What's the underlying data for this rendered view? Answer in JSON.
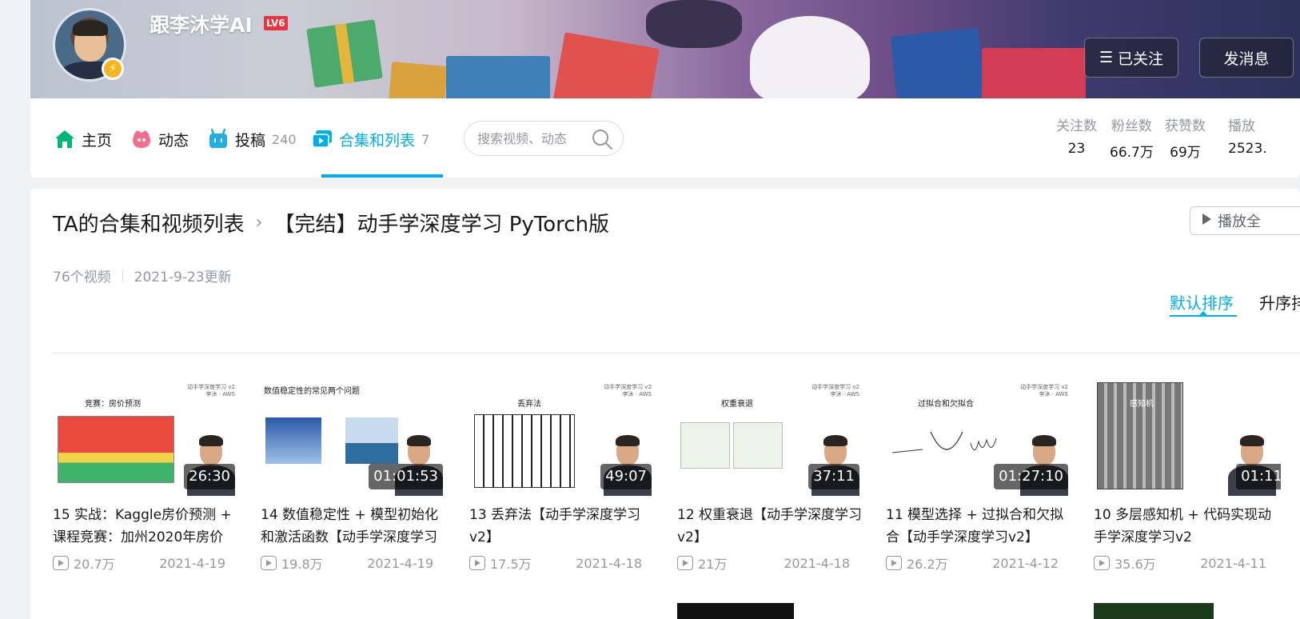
{
  "header": {
    "username": "跟李沐学AI",
    "level_badge": "LV6",
    "follow_button": "已关注",
    "message_button": "发消息"
  },
  "nav": {
    "items": [
      {
        "label": "主页",
        "count": "",
        "icon": "home-icon",
        "color": "#00b57a"
      },
      {
        "label": "动态",
        "count": "",
        "icon": "dynamic-icon",
        "color": "#f36f8e"
      },
      {
        "label": "投稿",
        "count": "240",
        "icon": "upload-icon",
        "color": "#23ade5"
      },
      {
        "label": "合集和列表",
        "count": "7",
        "icon": "collection-icon",
        "color": "#00aeec"
      }
    ],
    "active_index": 3,
    "search_placeholder": "搜索视频、动态",
    "stats": [
      {
        "label": "关注数",
        "value": "23"
      },
      {
        "label": "粉丝数",
        "value": "66.7万"
      },
      {
        "label": "获赞数",
        "value": "69万"
      },
      {
        "label": "播放",
        "value": "2523."
      }
    ]
  },
  "page": {
    "breadcrumb_root": "TA的合集和视频列表",
    "breadcrumb_current": "【完结】动手学深度学习 PyTorch版",
    "play_all": "播放全",
    "video_count": "76个视频",
    "updated": "2021-9-23更新",
    "sort_default": "默认排序",
    "sort_asc": "升序排"
  },
  "videos": [
    {
      "title": "15 实战：Kaggle房价预测 + 课程竞赛：加州2020年房价",
      "views": "20.7万",
      "date": "2021-4-19",
      "duration": "26:30",
      "slide_title": "竞赛：房价预测"
    },
    {
      "title": "14 数值稳定性 + 模型初始化和激活函数【动手学深度学习",
      "views": "19.8万",
      "date": "2021-4-19",
      "duration": "01:01:53",
      "slide_title": "数值稳定性的常见两个问题"
    },
    {
      "title": "13 丢弃法【动手学深度学习v2】",
      "views": "17.5万",
      "date": "2021-4-18",
      "duration": "49:07",
      "slide_title": "丢弃法"
    },
    {
      "title": "12 权重衰退【动手学深度学习v2】",
      "views": "21万",
      "date": "2021-4-18",
      "duration": "37:11",
      "slide_title": "权重衰退"
    },
    {
      "title": "11 模型选择 + 过拟合和欠拟合【动手学深度学习v2】",
      "views": "26.2万",
      "date": "2021-4-12",
      "duration": "01:27:10",
      "slide_title": "过拟合和欠拟合"
    },
    {
      "title": "10 多层感知机 + 代码实现动手学深度学习v2",
      "views": "35.6万",
      "date": "2021-4-11",
      "duration": "01:11:",
      "slide_title": "感知机"
    }
  ],
  "thumb_corner": [
    "动手学深度学习 v2",
    "李沐 · AWS"
  ]
}
